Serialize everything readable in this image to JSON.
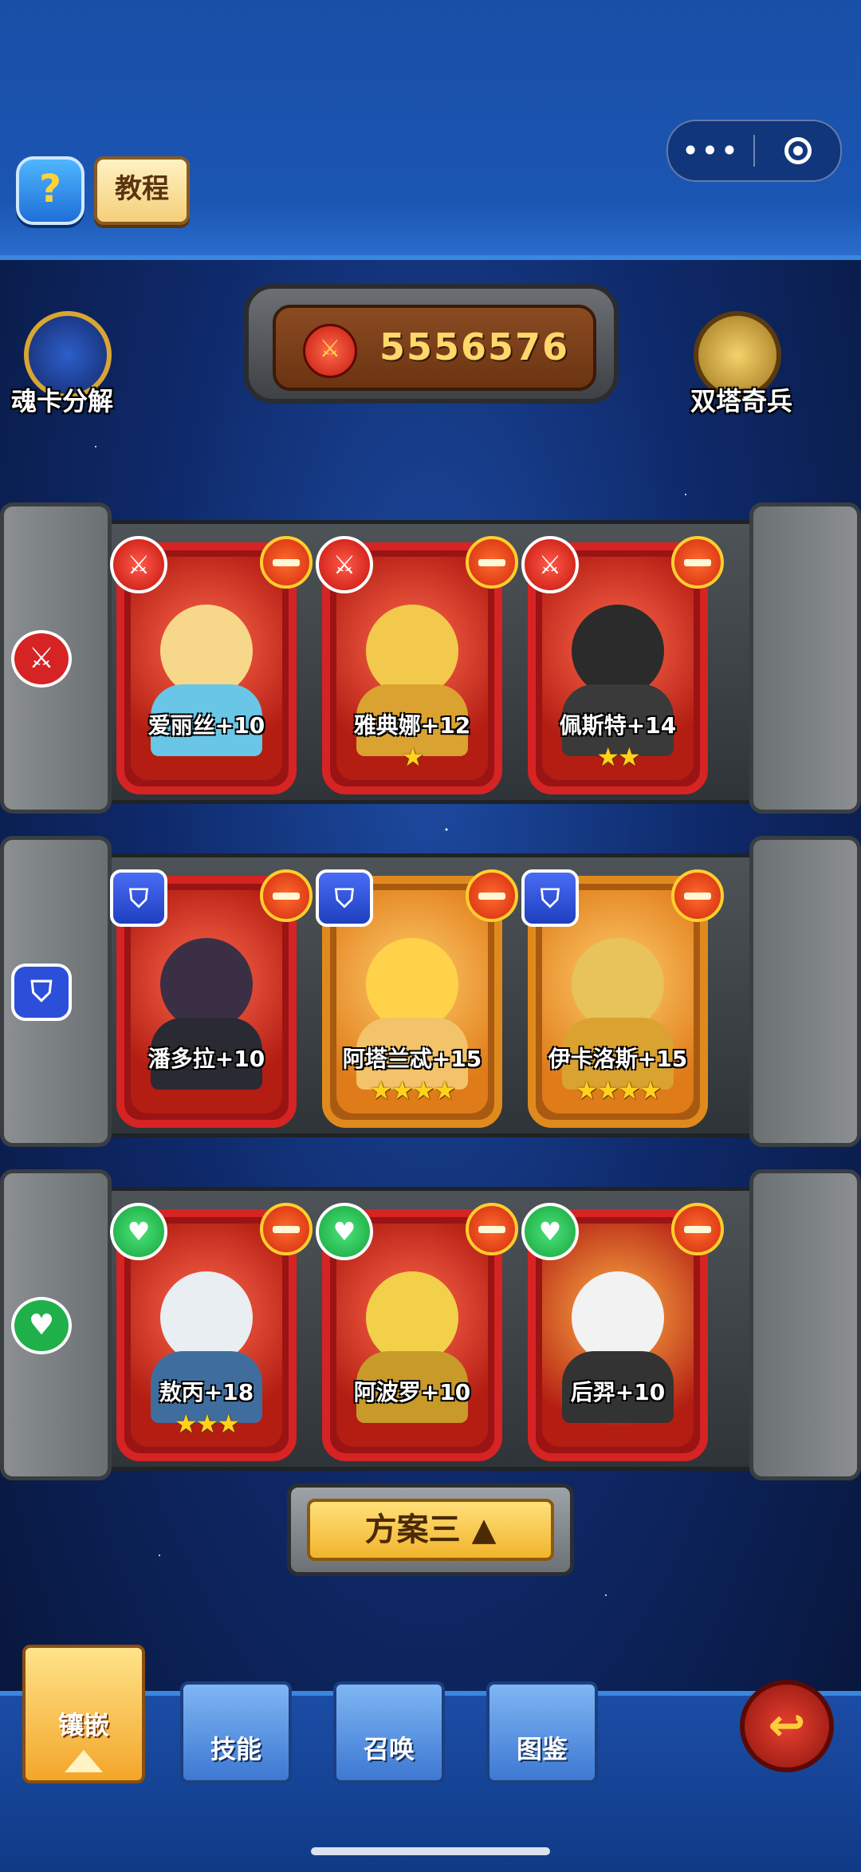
{
  "header": {
    "more_label": "•••",
    "help_label": "?",
    "tutorial_label": "教程"
  },
  "top_actions": {
    "left_label": "魂卡分解",
    "right_label": "双塔奇兵"
  },
  "score": {
    "icon_label": "⚔",
    "value": "5556576"
  },
  "rows": [
    {
      "type": "attack",
      "type_icon": "attack-sword-icon",
      "chip_label": "⚔",
      "cards": [
        {
          "name": "爱丽丝+10",
          "stars": "",
          "color": "red"
        },
        {
          "name": "雅典娜+12",
          "stars": "★",
          "color": "red"
        },
        {
          "name": "佩斯特+14",
          "stars": "★★",
          "color": "red"
        }
      ]
    },
    {
      "type": "defense",
      "type_icon": "defense-shield-icon",
      "chip_label": "⛉",
      "cards": [
        {
          "name": "潘多拉+10",
          "stars": "",
          "color": "red"
        },
        {
          "name": "阿塔兰忒+15",
          "stars": "★★★★",
          "color": "orange"
        },
        {
          "name": "伊卡洛斯+15",
          "stars": "★★★★",
          "color": "orange"
        }
      ]
    },
    {
      "type": "heal",
      "type_icon": "heal-heart-icon",
      "chip_label": "♥",
      "cards": [
        {
          "name": "敖丙+18",
          "stars": "★★★",
          "color": "red"
        },
        {
          "name": "阿波罗+10",
          "stars": "",
          "color": "red"
        },
        {
          "name": "后羿+10",
          "stars": "",
          "color": "red"
        }
      ]
    }
  ],
  "plan_button": {
    "label": "方案三 ▲"
  },
  "bottom_tabs": [
    {
      "label": "镶嵌",
      "active": true
    },
    {
      "label": "技能",
      "active": false
    },
    {
      "label": "召唤",
      "active": false
    },
    {
      "label": "图鉴",
      "active": false
    }
  ],
  "back_label": "↩",
  "colors": {
    "attack": "#d62323",
    "defense": "#2b4fd8",
    "heal": "#1fb04a",
    "accent": "#f3b42c"
  }
}
